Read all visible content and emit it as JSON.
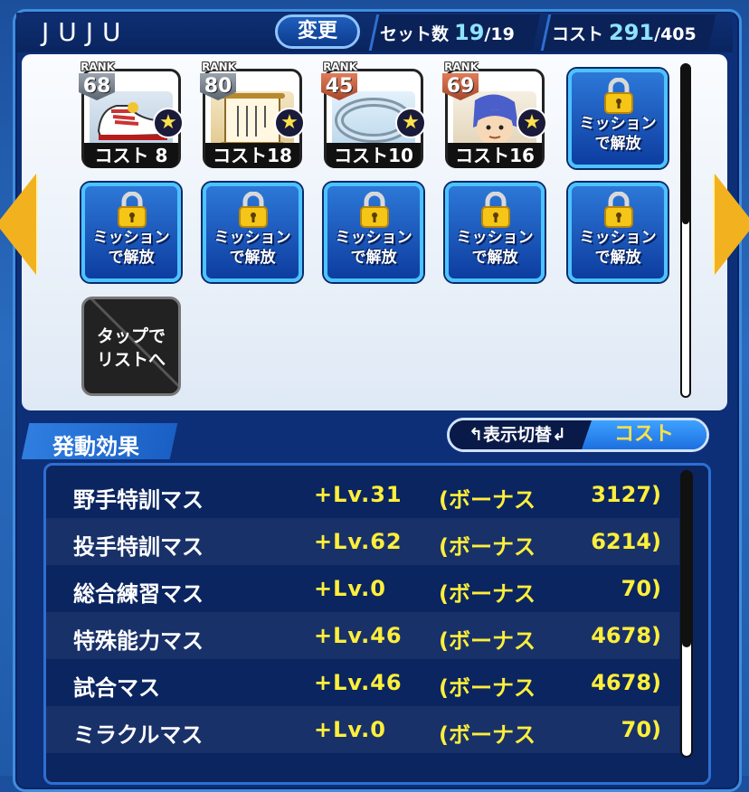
{
  "header": {
    "team_name": "JUJU",
    "change_label": "変更",
    "set_label": "セット数",
    "set_current": "19",
    "set_max": "/19",
    "cost_label": "コスト",
    "cost_current": "291",
    "cost_max": "/405"
  },
  "cards": [
    {
      "rank_word": "RANK",
      "rank": "68",
      "cost": "コスト 8",
      "art": "shoe"
    },
    {
      "rank_word": "RANK",
      "rank": "80",
      "cost": "コスト18",
      "art": "scroll"
    },
    {
      "rank_word": "RANK",
      "rank": "45",
      "cost": "コスト10",
      "art": "bracelet"
    },
    {
      "rank_word": "RANK",
      "rank": "69",
      "cost": "コスト16",
      "art": "portrait"
    }
  ],
  "locked_card_text": [
    "ミッション",
    "で解放"
  ],
  "tap_card_text": [
    "タップで",
    "リストへ"
  ],
  "effects_section": {
    "title": "発動効果",
    "toggle_label": "↰表示切替↲",
    "toggle_value": "コスト"
  },
  "effects": [
    {
      "name": "野手特訓マス",
      "lv": "+Lv.31",
      "bonus": "(ボーナス",
      "value": "3127)"
    },
    {
      "name": "投手特訓マス",
      "lv": "+Lv.62",
      "bonus": "(ボーナス",
      "value": "6214)"
    },
    {
      "name": "総合練習マス",
      "lv": "+Lv.0",
      "bonus": "(ボーナス",
      "value": "70)"
    },
    {
      "name": "特殊能力マス",
      "lv": "+Lv.46",
      "bonus": "(ボーナス",
      "value": "4678)"
    },
    {
      "name": "試合マス",
      "lv": "+Lv.46",
      "bonus": "(ボーナス",
      "value": "4678)"
    },
    {
      "name": "ミラクルマス",
      "lv": "+Lv.0",
      "bonus": "(ボーナス",
      "value": "70)"
    }
  ],
  "colors": {
    "accent_yellow": "#ffef3a",
    "panel_blue": "#0b2560",
    "locked_border": "#4cc3ff"
  }
}
